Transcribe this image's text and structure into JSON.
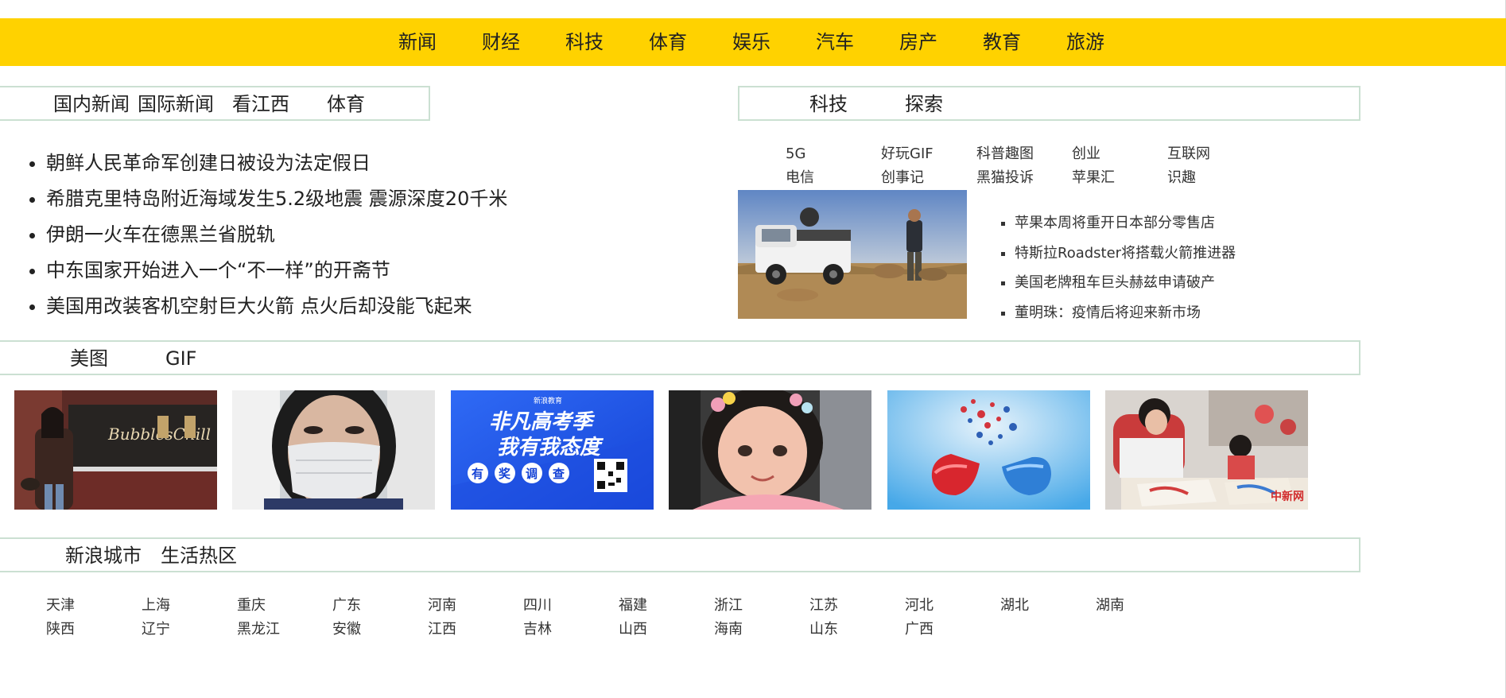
{
  "top_nav": [
    "新闻",
    "财经",
    "科技",
    "体育",
    "娱乐",
    "汽车",
    "房产",
    "教育",
    "旅游"
  ],
  "news_section": {
    "tabs": [
      "国内新闻",
      "国际新闻",
      "看江西",
      "体育"
    ],
    "items": [
      "朝鲜人民革命军创建日被设为法定假日",
      "希腊克里特岛附近海域发生5.2级地震 震源深度20千米",
      "伊朗一火车在德黑兰省脱轨",
      "中东国家开始进入一个“不一样”的开斋节",
      "美国用改装客机空射巨大火箭 点火后却没能飞起来"
    ]
  },
  "tech_section": {
    "tabs": [
      "科技",
      "探索"
    ],
    "links": [
      "5G",
      "好玩GIF",
      "科普趣图",
      "创业",
      "互联网",
      "电信",
      "创事记",
      "黑猫投诉",
      "苹果汇",
      "识趣"
    ],
    "headlines": [
      "苹果本周将重开日本部分零售店",
      "特斯拉Roadster将搭载火箭推进器",
      "美国老牌租车巨头赫兹申请破产",
      "董明珠：疫情后将迎来新市场"
    ]
  },
  "gallery_section": {
    "tabs": [
      "美图",
      "GIF"
    ],
    "thumbs": [
      {
        "name": "street-woman-photo",
        "sign": "BubblesChill"
      },
      {
        "name": "masked-face-photo"
      },
      {
        "name": "gaokao-survey-banner",
        "brand": "新浪教育",
        "title1": "非凡高考季",
        "title2": "我有我态度",
        "circles": [
          "有",
          "奖",
          "调",
          "查"
        ]
      },
      {
        "name": "girl-portrait-photo"
      },
      {
        "name": "medicine-capsule-photo"
      },
      {
        "name": "children-painting-photo",
        "watermark": "中新网"
      }
    ]
  },
  "city_section": {
    "tabs": [
      "新浪城市",
      "生活热区"
    ],
    "row1": [
      "天津",
      "上海",
      "重庆",
      "广东",
      "河南",
      "四川",
      "福建",
      "浙江",
      "江苏",
      "河北",
      "湖北",
      "湖南"
    ],
    "row2": [
      "陕西",
      "辽宁",
      "黑龙江",
      "安徽",
      "江西",
      "吉林",
      "山西",
      "海南",
      "山东",
      "广西"
    ]
  },
  "colors": {
    "nav_bg": "#ffd200",
    "section_border": "#cbe0d2"
  }
}
